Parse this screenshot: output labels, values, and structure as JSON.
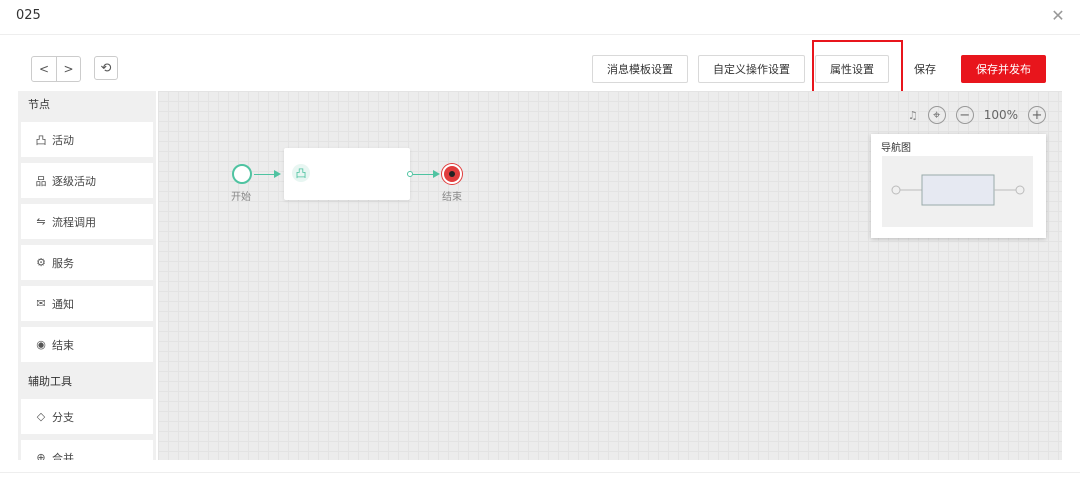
{
  "dialog": {
    "title": "025",
    "close_icon": "close-icon"
  },
  "toolbar": {
    "buttons": [
      "消息模板设置",
      "自定义操作设置",
      "属性设置",
      "保存",
      "保存并发布"
    ],
    "primary_color": "#e8151c"
  },
  "sidebar": {
    "section1_title": "节点",
    "nodes": [
      {
        "icon": "user-icon",
        "glyph": "凸",
        "label": "活动"
      },
      {
        "icon": "users-icon",
        "glyph": "品",
        "label": "逐级活动"
      },
      {
        "icon": "flow-call-icon",
        "glyph": "⇋",
        "label": "流程调用"
      },
      {
        "icon": "service-icon",
        "glyph": "⚙",
        "label": "服务"
      },
      {
        "icon": "mail-icon",
        "glyph": "✉",
        "label": "通知"
      },
      {
        "icon": "end-icon",
        "glyph": "◉",
        "label": "结束"
      }
    ],
    "section2_title": "辅助工具",
    "tools": [
      {
        "icon": "branch-icon",
        "glyph": "◇",
        "label": "分支"
      },
      {
        "icon": "merge-icon",
        "glyph": "⊕",
        "label": "合并"
      }
    ]
  },
  "canvas": {
    "zoom": "100%",
    "start_label": "开始",
    "end_label": "结束",
    "minimap_title": "导航图",
    "accent": "#4fc3a1",
    "end_color": "#e03c3c"
  }
}
